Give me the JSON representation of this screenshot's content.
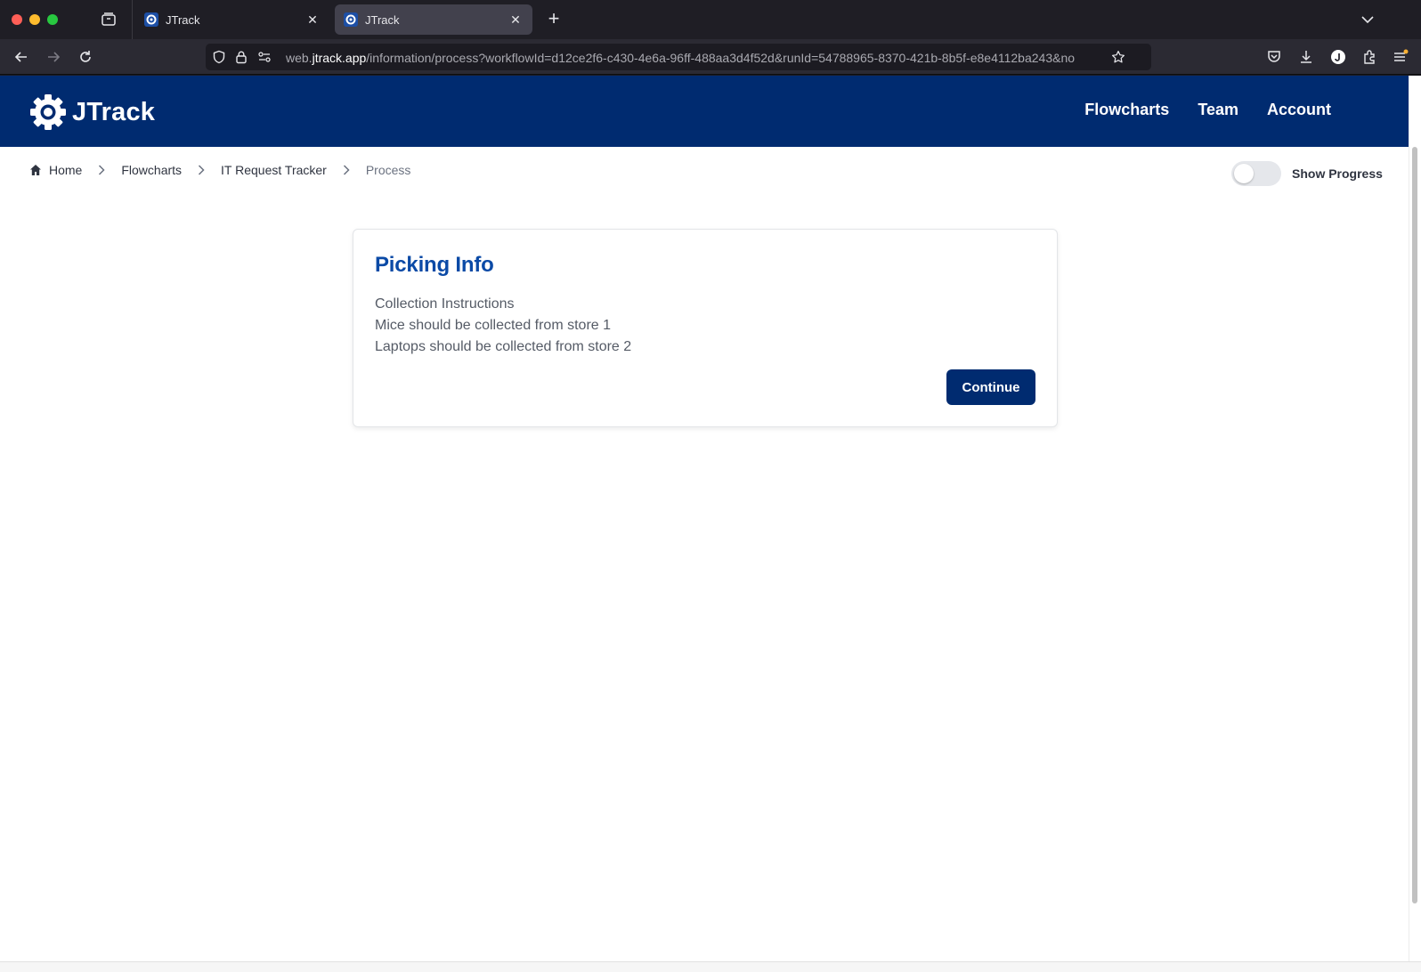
{
  "browser": {
    "tabs": [
      {
        "label": "JTrack",
        "active": false
      },
      {
        "label": "JTrack",
        "active": true
      }
    ],
    "url_prefix": "web.",
    "url_host": "jtrack.app",
    "url_path": "/information/process?workflowId=d12ce2f6-c430-4e6a-96ff-488aa3d4f52d&runId=54788965-8370-421b-8b5f-e8e4112ba243&no"
  },
  "header": {
    "brand": "JTrack",
    "nav": [
      "Flowcharts",
      "Team",
      "Account"
    ]
  },
  "breadcrumb": [
    "Home",
    "Flowcharts",
    "IT Request Tracker",
    "Process"
  ],
  "progress_toggle": {
    "label": "Show Progress",
    "on": false
  },
  "card": {
    "title": "Picking Info",
    "lines": [
      "Collection Instructions",
      "Mice should be collected from store 1",
      "Laptops should be collected from store 2"
    ],
    "button": "Continue"
  },
  "colors": {
    "brand": "#002b70",
    "title": "#0b4aa6"
  }
}
